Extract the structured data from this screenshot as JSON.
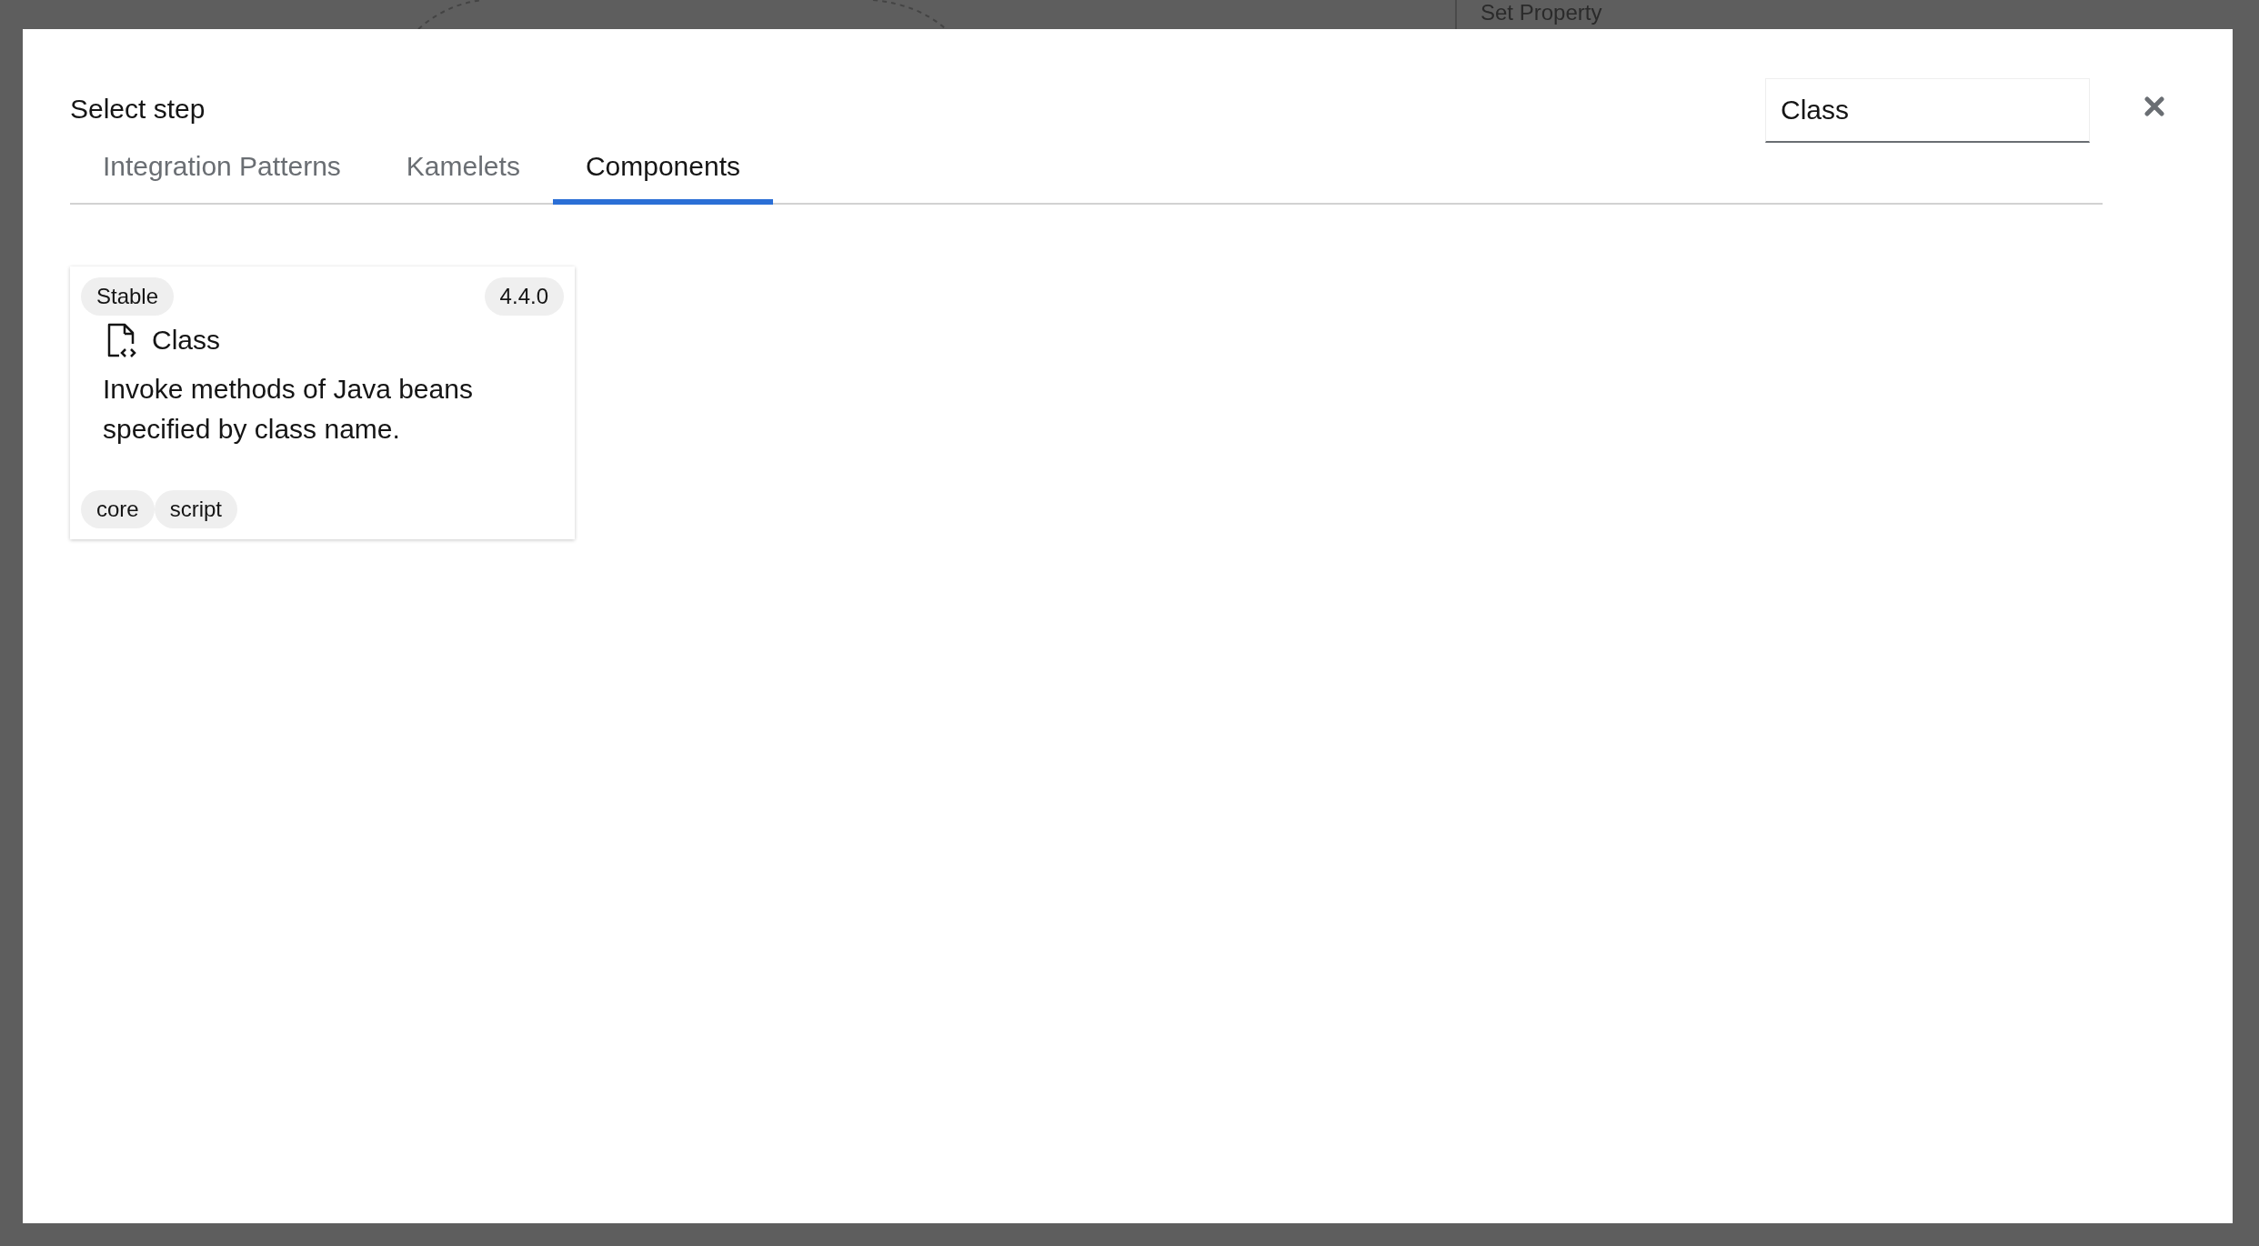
{
  "backdrop": {
    "panel_title": "Set Property"
  },
  "dialog": {
    "title": "Select step",
    "search": {
      "value": "Class"
    },
    "tabs": [
      {
        "label": "Integration Patterns",
        "selected": false
      },
      {
        "label": "Kamelets",
        "selected": false
      },
      {
        "label": "Components",
        "selected": true
      }
    ],
    "cards": [
      {
        "support_level": "Stable",
        "version": "4.4.0",
        "title": "Class",
        "description": "Invoke methods of Java beans specified by class name.",
        "tags": [
          "core",
          "script"
        ]
      }
    ]
  }
}
